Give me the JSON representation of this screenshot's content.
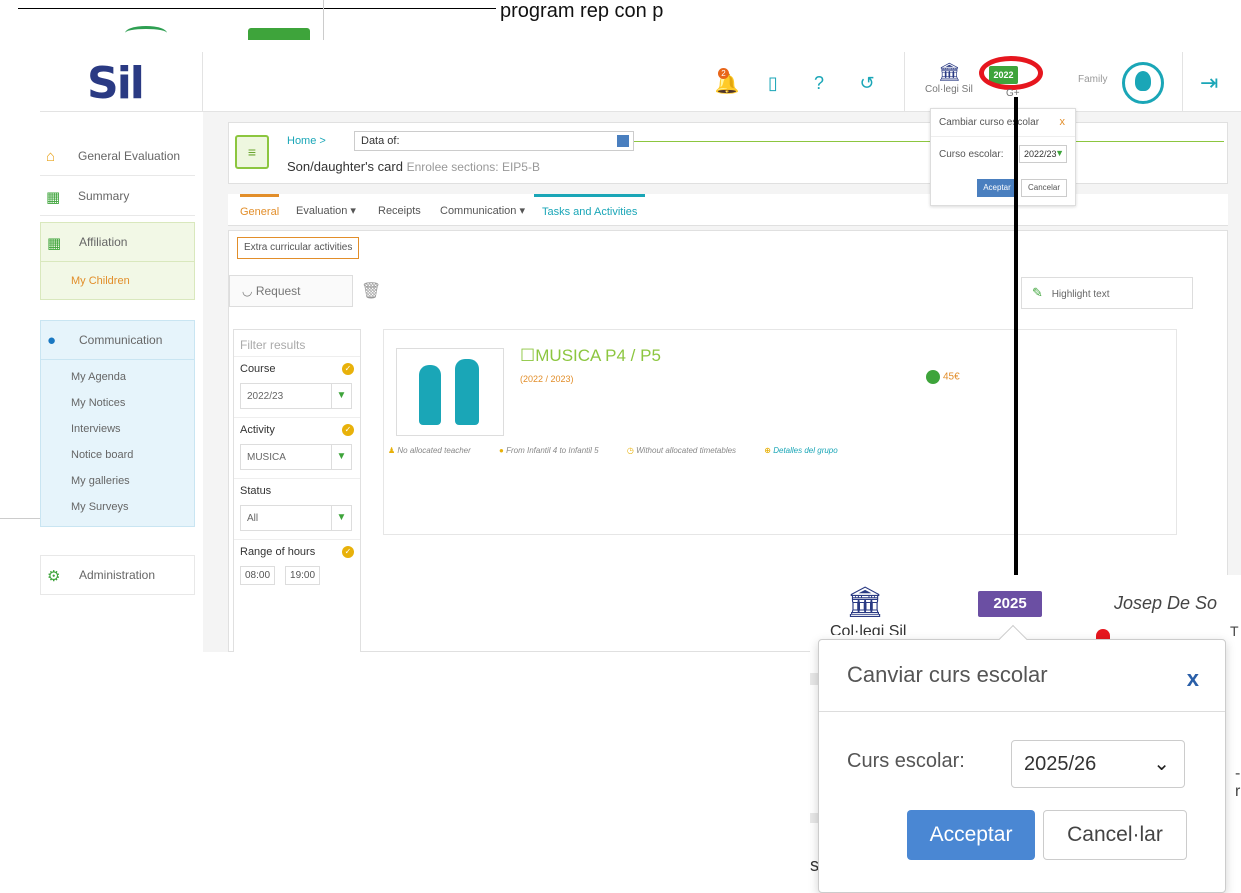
{
  "top_strip": {
    "text": "program    rep     con     p"
  },
  "header": {
    "logo": "Sil",
    "bell_count": "2",
    "school_name": "Col·legi Sil",
    "year_badge": "2022",
    "gplus": "G+",
    "user_role": "Family",
    "icons": [
      "bell-icon",
      "mobile-icon",
      "help-icon",
      "history-icon",
      "school-icon",
      "avatar",
      "logout-icon"
    ]
  },
  "sidebar": {
    "general_evaluation": "General Evaluation",
    "summary": "Summary",
    "affiliation": "Affiliation",
    "my_children": "My Children",
    "communication": "Communication",
    "communication_items": [
      "My Agenda",
      "My Notices",
      "Interviews",
      "Notice board",
      "My galleries",
      "My Surveys"
    ],
    "administration": "Administration"
  },
  "card": {
    "breadcrumb": "Home >",
    "data_of": "Data of:",
    "title": "Son/daughter's card",
    "subtitle": "Enrolee sections: EIP5-B"
  },
  "tabs": [
    "General",
    "Evaluation ▾",
    "Receipts",
    "Communication ▾",
    "Tasks and Activities"
  ],
  "content": {
    "extra_button": "Extra curricular activities",
    "request_button": "Request",
    "highlight_button": "Highlight text"
  },
  "filter": {
    "title": "Filter results",
    "course_label": "Course",
    "course_value": "2022/23",
    "activity_label": "Activity",
    "activity_value": "MUSICA",
    "status_label": "Status",
    "status_value": "All",
    "hours_label": "Range of hours",
    "hours_from": "08:00",
    "hours_to": "19:00"
  },
  "activity": {
    "title": "MUSICA P4 / P5",
    "year": "(2022 / 2023)",
    "price": "45€",
    "teacher": "No allocated teacher",
    "range": "From Infantil 4 to Infantil 5",
    "timetable": "Without allocated timetables",
    "details": "Detalles del grupo"
  },
  "small_popup": {
    "title": "Cambiar curso escolar",
    "close": "x",
    "label": "Curso escolar:",
    "value": "2022/23",
    "accept": "Aceptar",
    "cancel": "Cancelar"
  },
  "inset": {
    "school": "Col·legi Sil",
    "year_badge": "2025",
    "user_name": "Josep De So",
    "right_char_1": "T",
    "right_char_2": "-r",
    "bottom_text": "st",
    "popup": {
      "title": "Canviar curs escolar",
      "close": "x",
      "label": "Curs escolar:",
      "value": "2025/26",
      "accept": "Acceptar",
      "cancel": "Cancel·lar"
    }
  },
  "colors": {
    "brand_blue": "#2a3a83",
    "teal": "#1aa6b7",
    "green": "#3ea43b",
    "orange": "#e28e2a",
    "red_highlight": "#e6161e",
    "purple_badge": "#6b4fa3",
    "accept_blue": "#4a87d3"
  }
}
